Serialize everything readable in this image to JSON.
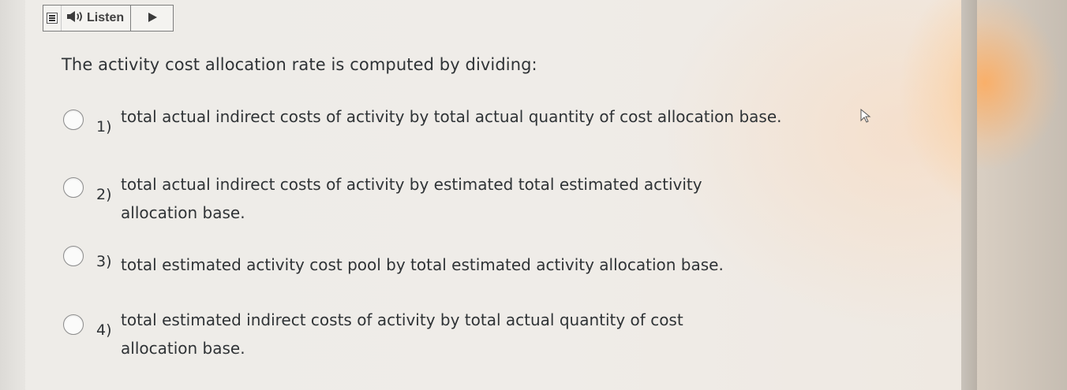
{
  "toolbar": {
    "listen_label": "Listen"
  },
  "question": {
    "text": "The activity cost allocation rate is computed by dividing:"
  },
  "options": [
    {
      "number": "1)",
      "text": "total actual indirect costs of activity by total actual quantity of cost allocation base."
    },
    {
      "number": "2)",
      "text": "total actual indirect costs of activity by estimated total estimated activity allocation base."
    },
    {
      "number": "3)",
      "text": "total estimated activity cost pool by total estimated activity allocation base."
    },
    {
      "number": "4)",
      "text": "total estimated indirect costs of activity by total actual quantity of cost allocation base."
    }
  ],
  "icons": {
    "menu": "menu-icon",
    "speaker": "speaker-icon",
    "play": "play-icon",
    "cursor": "mouse-cursor-icon"
  }
}
